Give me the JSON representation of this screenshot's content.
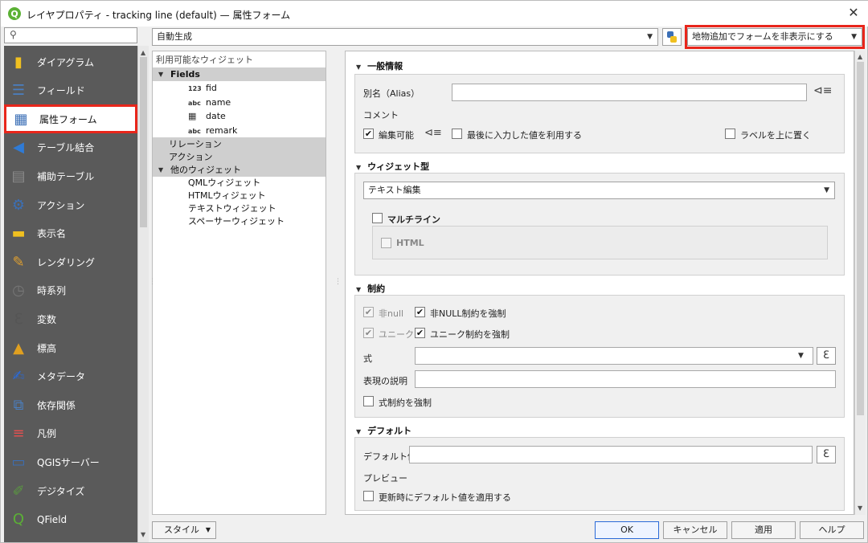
{
  "window": {
    "title": "レイヤプロパティ - tracking line (default) — 属性フォーム"
  },
  "search": {
    "placeholder": ""
  },
  "sidebar": {
    "items": [
      {
        "label": "ダイアグラム",
        "icon": "diagram-icon",
        "color": "#f0c020"
      },
      {
        "label": "フィールド",
        "icon": "fields-icon",
        "color": "#4a7fc1"
      },
      {
        "label": "属性フォーム",
        "icon": "form-icon",
        "color": "#3b6fb6"
      },
      {
        "label": "テーブル結合",
        "icon": "join-icon",
        "color": "#2f7bd6"
      },
      {
        "label": "補助テーブル",
        "icon": "database-icon",
        "color": "#8a8a8a"
      },
      {
        "label": "アクション",
        "icon": "gear-icon",
        "color": "#3b6fb6"
      },
      {
        "label": "表示名",
        "icon": "tooltip-icon",
        "color": "#f0c020"
      },
      {
        "label": "レンダリング",
        "icon": "brush-icon",
        "color": "#e0a030"
      },
      {
        "label": "時系列",
        "icon": "clock-icon",
        "color": "#777"
      },
      {
        "label": "変数",
        "icon": "epsilon-icon",
        "color": "#555"
      },
      {
        "label": "標高",
        "icon": "elevation-icon",
        "color": "#e0a020"
      },
      {
        "label": "メタデータ",
        "icon": "metadata-icon",
        "color": "#2a6ad8"
      },
      {
        "label": "依存関係",
        "icon": "dependencies-icon",
        "color": "#4a7fc1"
      },
      {
        "label": "凡例",
        "icon": "legend-icon",
        "color": "#e05050"
      },
      {
        "label": "QGISサーバー",
        "icon": "server-icon",
        "color": "#3b6fb6"
      },
      {
        "label": "デジタイズ",
        "icon": "digitize-icon",
        "color": "#5a9a40"
      },
      {
        "label": "QField",
        "icon": "qfield-icon",
        "color": "#5bb135"
      }
    ]
  },
  "toolbar": {
    "layout_combo": "自動生成",
    "form_suppress_combo": "地物追加でフォームを非表示にする"
  },
  "tree": {
    "header": "利用可能なウィジェット",
    "fields_label": "Fields",
    "fields": [
      {
        "type": "123",
        "name": "fid"
      },
      {
        "type": "abc",
        "name": "name"
      },
      {
        "type": "cal",
        "name": "date"
      },
      {
        "type": "abc",
        "name": "remark"
      }
    ],
    "relations_label": "リレーション",
    "actions_label": "アクション",
    "other_label": "他のウィジェット",
    "other_items": [
      "QMLウィジェット",
      "HTMLウィジェット",
      "テキストウィジェット",
      "スペーサーウィジェット"
    ]
  },
  "general": {
    "title": "一般情報",
    "alias_label": "別名（Alias）",
    "alias_value": "",
    "comment_label": "コメント",
    "editable_label": "編集可能",
    "reuse_label": "最後に入力した値を利用する",
    "label_on_top": "ラベルを上に置く"
  },
  "widget_type": {
    "title": "ウィジェット型",
    "value": "テキスト編集",
    "multiline_label": "マルチライン",
    "html_label": "HTML"
  },
  "constraints": {
    "title": "制約",
    "notnull_label": "非null",
    "enforce_notnull_label": "非NULL制約を強制",
    "unique_label": "ユニーク",
    "enforce_unique_label": "ユニーク制約を強制",
    "expression_label": "式",
    "expression_value": "",
    "description_label": "表現の説明",
    "description_value": "",
    "enforce_expression_label": "式制約を強制"
  },
  "defaults": {
    "title": "デフォルト",
    "default_label": "デフォルト値",
    "default_value": "",
    "preview_label": "プレビュー",
    "apply_on_update_label": "更新時にデフォルト値を適用する"
  },
  "footer": {
    "style": "スタイル",
    "ok": "OK",
    "cancel": "キャンセル",
    "apply": "適用",
    "help": "ヘルプ"
  },
  "colors": {
    "highlight": "#e8261b",
    "sidebar_bg": "#5a5a5a"
  }
}
